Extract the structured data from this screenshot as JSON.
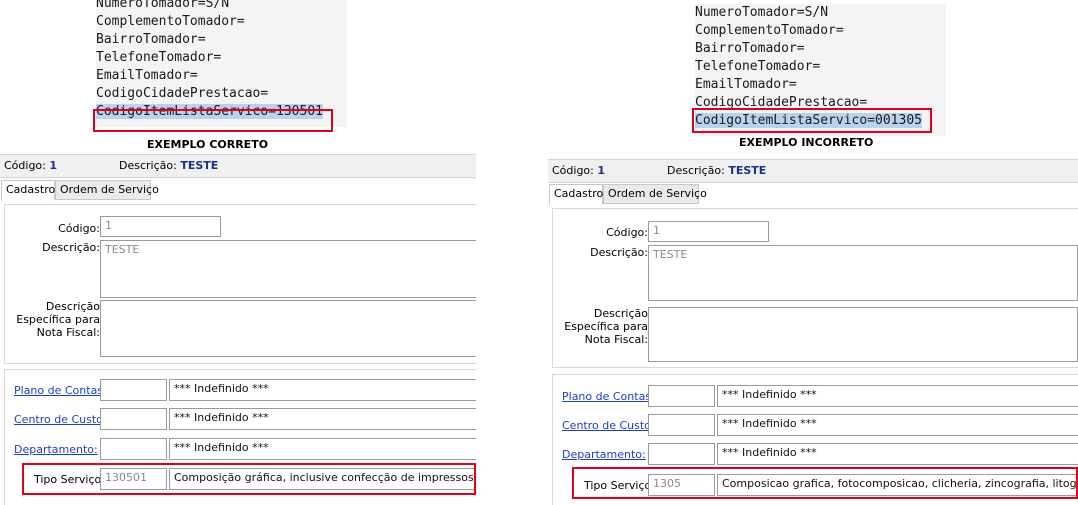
{
  "left": {
    "code_lines": [
      "NumeroTomador=S/N",
      "ComplementoTomador=",
      "BairroTomador=",
      "TelefoneTomador=",
      "EmailTomador=",
      "CodigoCidadePrestacao="
    ],
    "highlight_line": "CodigoItemListaServico=130501",
    "caption": "EXEMPLO CORRETO",
    "codigo_label": "Código:",
    "codigo_value": "1",
    "descricao_label": "Descrição:",
    "descricao_value": "TESTE",
    "tabs": [
      "Cadastro",
      "Ordem de Serviço"
    ],
    "form": {
      "codigo_label": "Código:",
      "codigo_value": "1",
      "descricao_label": "Descrição:",
      "descricao_value": "TESTE",
      "desc_nf_lines": [
        "Descrição",
        "Específica para",
        "Nota Fiscal:"
      ],
      "plano_label": "Plano de Contas:",
      "plano_value": "*** Indefinido ***",
      "centro_label": "Centro de Custo:",
      "centro_value": "*** Indefinido ***",
      "depto_label": "Departamento:",
      "depto_value": "*** Indefinido ***",
      "tipo_label": "Tipo Serviço:",
      "tipo_code": "130501",
      "tipo_desc": "Composição gráfica, inclusive confecção de impressos gráficos,"
    }
  },
  "right": {
    "code_lines": [
      "NumeroTomador=S/N",
      "ComplementoTomador=",
      "BairroTomador=",
      "TelefoneTomador=",
      "EmailTomador=",
      "CodigoCidadePrestacao="
    ],
    "highlight_line": "CodigoItemListaServico=001305",
    "caption": "EXEMPLO INCORRETO",
    "codigo_label": "Código:",
    "codigo_value": "1",
    "descricao_label": "Descrição:",
    "descricao_value": "TESTE",
    "tabs": [
      "Cadastro",
      "Ordem de Serviço"
    ],
    "form": {
      "codigo_label": "Código:",
      "codigo_value": "1",
      "descricao_label": "Descrição:",
      "descricao_value": "TESTE",
      "desc_nf_lines": [
        "Descrição",
        "Específica para",
        "Nota Fiscal:"
      ],
      "plano_label": "Plano de Contas:",
      "plano_value": "*** Indefinido ***",
      "centro_label": "Centro de Custo:",
      "centro_value": "*** Indefinido ***",
      "depto_label": "Departamento:",
      "depto_value": "*** Indefinido ***",
      "tipo_label": "Tipo Serviço:",
      "tipo_code": "1305",
      "tipo_desc": "Composicao grafica, fotocomposicao, clicheria, zincografia, litografia, fotol"
    }
  },
  "colors": {
    "highlight_border": "#e0001a",
    "selection": "#b9d2ee",
    "value_blue": "#1d2e8a",
    "link_blue": "#1d3fc4"
  }
}
